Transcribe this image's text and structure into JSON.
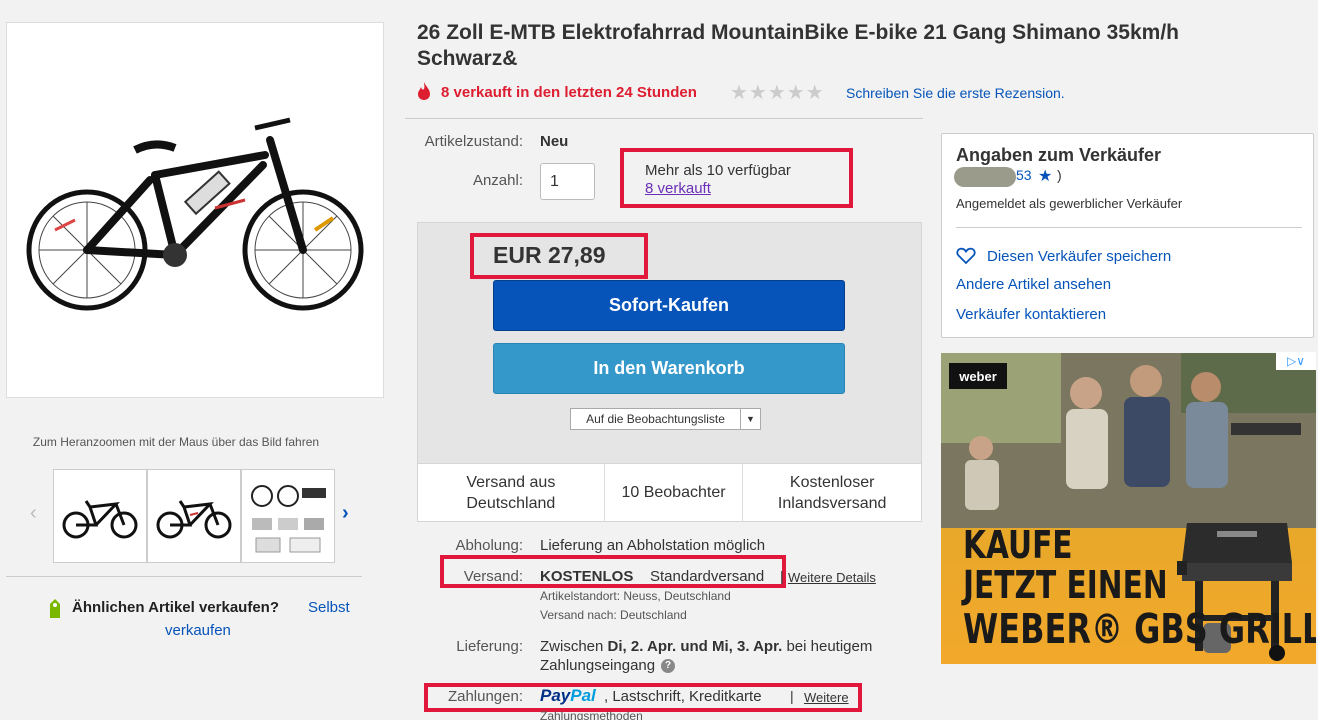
{
  "product": {
    "title": "26 Zoll E-MTB Elektrofahrrad MountainBike E-bike 21 Gang Shimano 35km/h Schwarz&",
    "sold_recent": "8 verkauft in den letzten 24 Stunden",
    "rating_stars": "★★★★★",
    "review_link": "Schreiben Sie die erste Rezension."
  },
  "gallery": {
    "zoom_hint": "Zum Heranzoomen mit der Maus über das Bild fahren",
    "prev_arrow": "‹",
    "next_arrow": "›"
  },
  "sell_similar": {
    "question": "Ähnlichen Artikel verkaufen?",
    "link_part1": "Selbst",
    "link_part2": "verkaufen"
  },
  "details": {
    "condition_label": "Artikelzustand:",
    "condition_value": "Neu",
    "quantity_label": "Anzahl:",
    "quantity_value": "1",
    "availability": "Mehr als 10 verfügbar",
    "sold_count_link": "8 verkauft"
  },
  "buy_box": {
    "price": "EUR 27,89",
    "buy_now": "Sofort-Kaufen",
    "add_to_cart": "In den Warenkorb",
    "watch_list": "Auf die Beobachtungsliste",
    "stats": [
      "Versand aus Deutschland",
      "10 Beobachter",
      "Kostenloser Inlandsversand"
    ]
  },
  "shipping": {
    "pickup_label": "Abholung:",
    "pickup_value": "Lieferung an Abholstation möglich",
    "shipping_label": "Versand:",
    "shipping_free": "KOSTENLOS",
    "shipping_type": "Standardversand",
    "separator": "|",
    "more_details": "Weitere Details",
    "location": "Artikelstandort:  Neuss, Deutschland",
    "ships_to": "Versand nach:  Deutschland",
    "delivery_label": "Lieferung:",
    "delivery_line1_prefix": "Zwischen ",
    "delivery_dates": "Di, 2. Apr. und Mi, 3. Apr.",
    "delivery_line1_suffix": " bei heutigem",
    "delivery_line2": "Zahlungseingang",
    "help": "?",
    "payments_label": "Zahlungen:",
    "paypal_pay": "Pay",
    "paypal_pal": "Pal",
    "payment_methods": ",  Lastschrift,  Kreditkarte",
    "more_payments": "Weitere",
    "more_payments_line2": "Zahlungsmethoden"
  },
  "seller": {
    "title": "Angaben zum Verkäufer",
    "score": "53",
    "star": "★",
    "paren": ")",
    "type": "Angemeldet als gewerblicher Verkäufer",
    "save": "Diesen Verkäufer speichern",
    "other_items": "Andere Artikel ansehen",
    "contact": "Verkäufer kontaktieren"
  },
  "ad": {
    "brand": "weber",
    "line1": "KAUFE",
    "line2": "JETZT EINEN",
    "line3": "WEBER® GBS GRILL",
    "choices": "▷∨"
  },
  "colors": {
    "link": "#0654ba",
    "highlight": "#e2173c",
    "alert": "#dd1e31",
    "buy_now": "#0654ba",
    "add_to_cart": "#3498ca",
    "paypal_dark": "#003087",
    "paypal_light": "#009cde"
  }
}
